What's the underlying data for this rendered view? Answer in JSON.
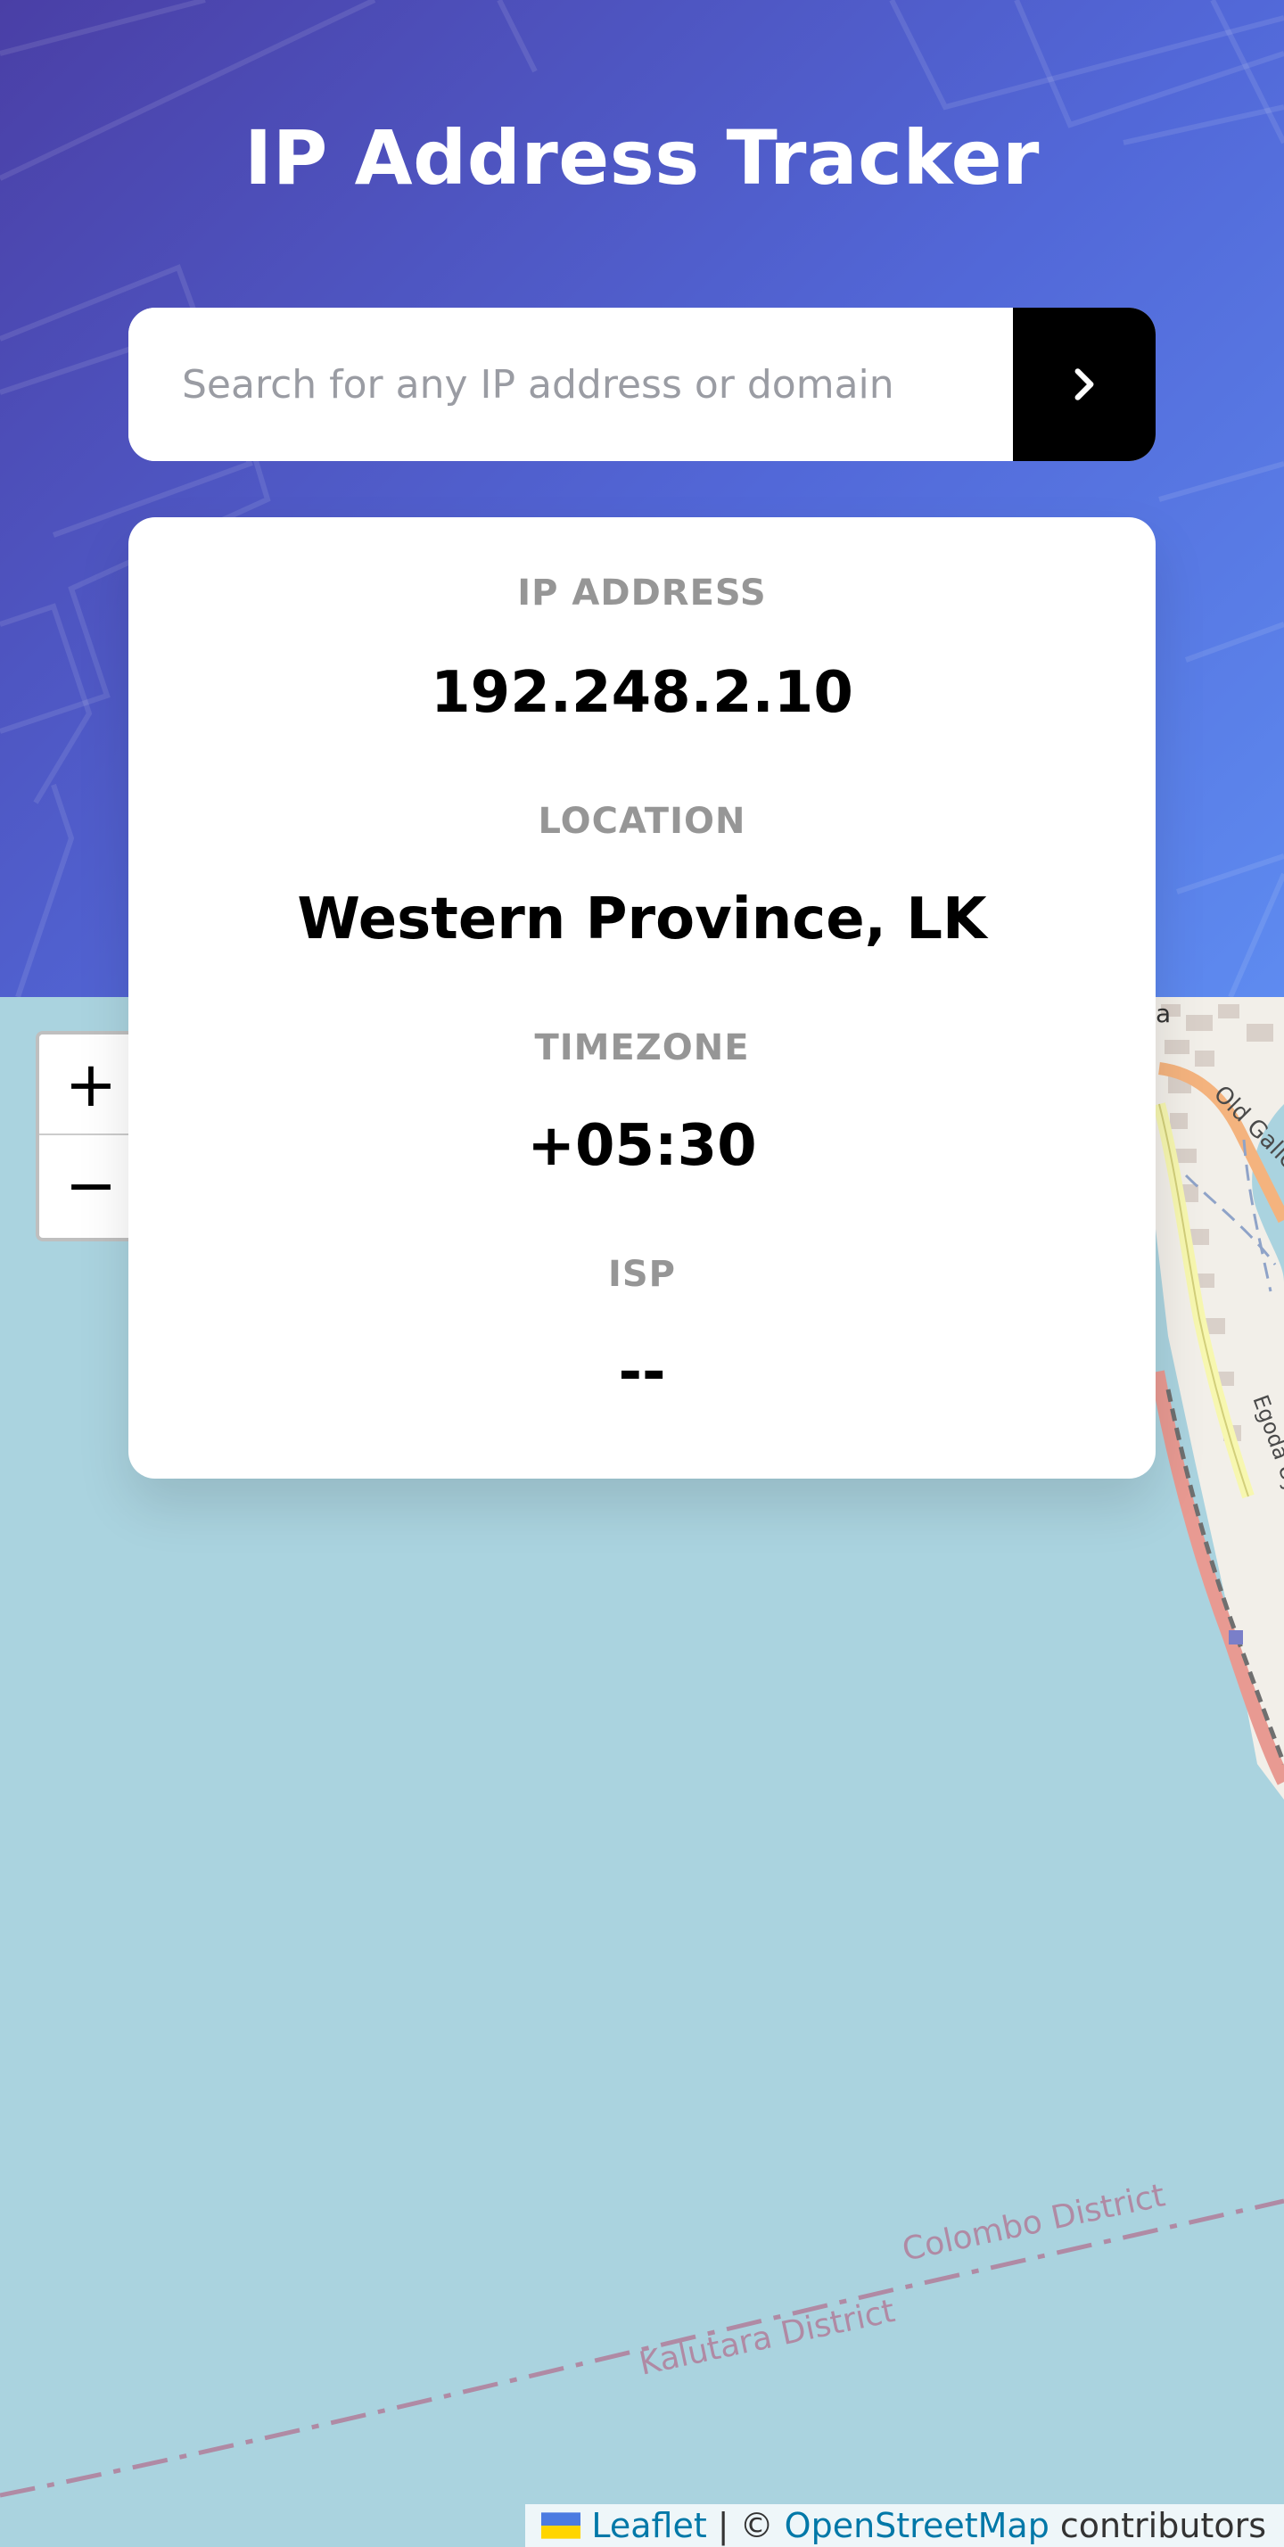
{
  "app": {
    "title": "IP Address Tracker"
  },
  "search": {
    "placeholder": "Search for any IP address or domain",
    "value": "",
    "submit_icon": "chevron-right-icon"
  },
  "info": {
    "ip_label": "IP ADDRESS",
    "ip_value": "192.248.2.10",
    "location_label": "LOCATION",
    "location_value": "Western Province, LK",
    "timezone_label": "TIMEZONE",
    "timezone_value": "+05:30",
    "isp_label": "ISP",
    "isp_value": "--"
  },
  "map": {
    "zoom_in_label": "+",
    "zoom_out_label": "−",
    "district_north": "Colombo District",
    "district_south": "Kalutara District",
    "road_1": "Old Galle",
    "road_2": "Egoda Uyana Road",
    "partial_label": "a",
    "attribution": {
      "leaflet": "Leaflet",
      "separator": "|",
      "copyright": "©",
      "osm": "OpenStreetMap",
      "contributors": "contributors"
    },
    "colors": {
      "water": "#aad3df",
      "land": "#f2efe9",
      "boundary": "#b08aa4"
    }
  },
  "colors": {
    "header_gradient_start": "#4a3fa6",
    "header_gradient_end": "#5e8bf0",
    "button_bg": "#000000",
    "label_gray": "#969696"
  }
}
